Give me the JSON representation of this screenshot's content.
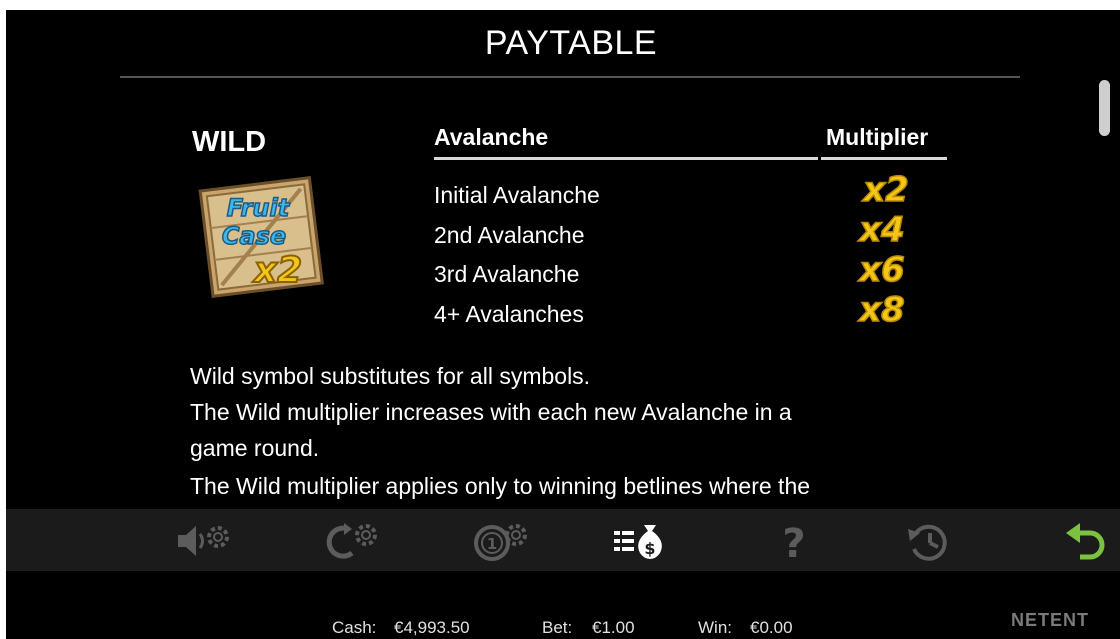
{
  "header": {
    "title": "PAYTABLE"
  },
  "wild": {
    "title": "WILD",
    "symbol_text_top": "Fruit",
    "symbol_text_mid": "Case",
    "symbol_text_mult": "x2",
    "table": {
      "col_avalanche": "Avalanche",
      "col_multiplier": "Multiplier",
      "rows": [
        {
          "label": "Initial Avalanche",
          "multiplier": "x2"
        },
        {
          "label": "2nd Avalanche",
          "multiplier": "x4"
        },
        {
          "label": "3rd Avalanche",
          "multiplier": "x6"
        },
        {
          "label": "4+ Avalanches",
          "multiplier": "x8"
        }
      ]
    },
    "description": [
      "Wild symbol substitutes for all symbols.",
      "The Wild multiplier increases with each new Avalanche in a",
      "game round.",
      "The Wild multiplier applies only to winning betlines where the"
    ]
  },
  "toolbar": {
    "buttons": [
      {
        "name": "sound-settings-button",
        "icon": "speaker-gear-icon"
      },
      {
        "name": "autoplay-settings-button",
        "icon": "autoplay-gear-icon"
      },
      {
        "name": "bet-settings-button",
        "icon": "coin-gear-icon"
      },
      {
        "name": "paytable-button",
        "icon": "money-bag-list-icon",
        "active": true
      },
      {
        "name": "help-button",
        "icon": "question-icon"
      },
      {
        "name": "history-button",
        "icon": "history-clock-icon"
      },
      {
        "name": "back-button",
        "icon": "return-arrow-icon"
      }
    ]
  },
  "status": {
    "cash_label": "Cash:",
    "cash_value": "€4,993.50",
    "bet_label": "Bet:",
    "bet_value": "€1.00",
    "win_label": "Win:",
    "win_value": "€0.00",
    "brand": "NETENT"
  },
  "colors": {
    "background": "#000000",
    "toolbar": "#1b1b1b",
    "icon_inactive": "#5c5c5c",
    "icon_active": "#ffffff",
    "back_green": "#7bc142",
    "multiplier_gold": "#f5c518"
  }
}
